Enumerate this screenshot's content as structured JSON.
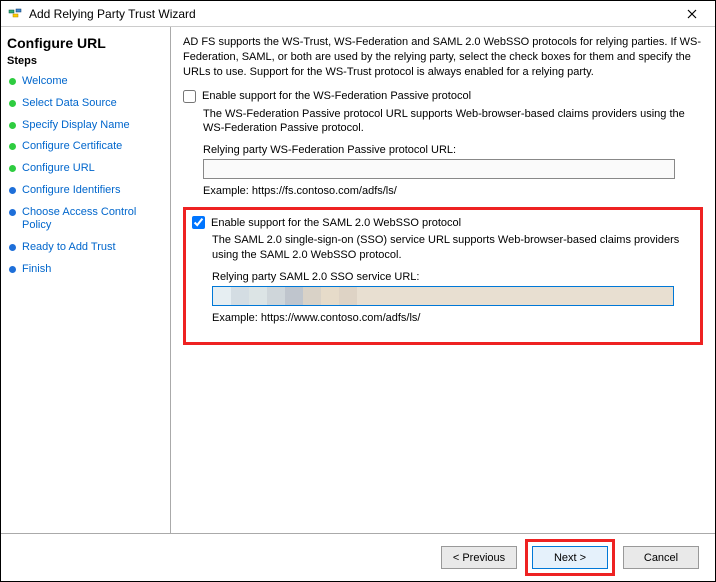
{
  "window": {
    "title": "Add Relying Party Trust Wizard"
  },
  "header": {
    "title": "Configure URL"
  },
  "sidebar": {
    "title": "Steps",
    "items": [
      {
        "label": "Welcome",
        "state": "done"
      },
      {
        "label": "Select Data Source",
        "state": "done"
      },
      {
        "label": "Specify Display Name",
        "state": "done"
      },
      {
        "label": "Configure Certificate",
        "state": "done"
      },
      {
        "label": "Configure URL",
        "state": "done"
      },
      {
        "label": "Configure Identifiers",
        "state": "todo"
      },
      {
        "label": "Choose Access Control Policy",
        "state": "todo"
      },
      {
        "label": "Ready to Add Trust",
        "state": "todo"
      },
      {
        "label": "Finish",
        "state": "todo"
      }
    ]
  },
  "main": {
    "intro": "AD FS supports the WS-Trust, WS-Federation and SAML 2.0 WebSSO protocols for relying parties.  If WS-Federation, SAML, or both are used by the relying party, select the check boxes for them and specify the URLs to use.  Support for the WS-Trust protocol is always enabled for a relying party.",
    "wsfed": {
      "checkbox_label": "Enable support for the WS-Federation Passive protocol",
      "checked": false,
      "description": "The WS-Federation Passive protocol URL supports Web-browser-based claims providers using the WS-Federation Passive protocol.",
      "field_label": "Relying party WS-Federation Passive protocol URL:",
      "value": "",
      "example": "Example: https://fs.contoso.com/adfs/ls/"
    },
    "saml": {
      "checkbox_label": "Enable support for the SAML 2.0 WebSSO protocol",
      "checked": true,
      "description": "The SAML 2.0 single-sign-on (SSO) service URL supports Web-browser-based claims providers using the SAML 2.0 WebSSO protocol.",
      "field_label": "Relying party SAML 2.0 SSO service URL:",
      "value": "",
      "example": "Example: https://www.contoso.com/adfs/ls/"
    }
  },
  "footer": {
    "previous": "< Previous",
    "next": "Next >",
    "cancel": "Cancel"
  }
}
